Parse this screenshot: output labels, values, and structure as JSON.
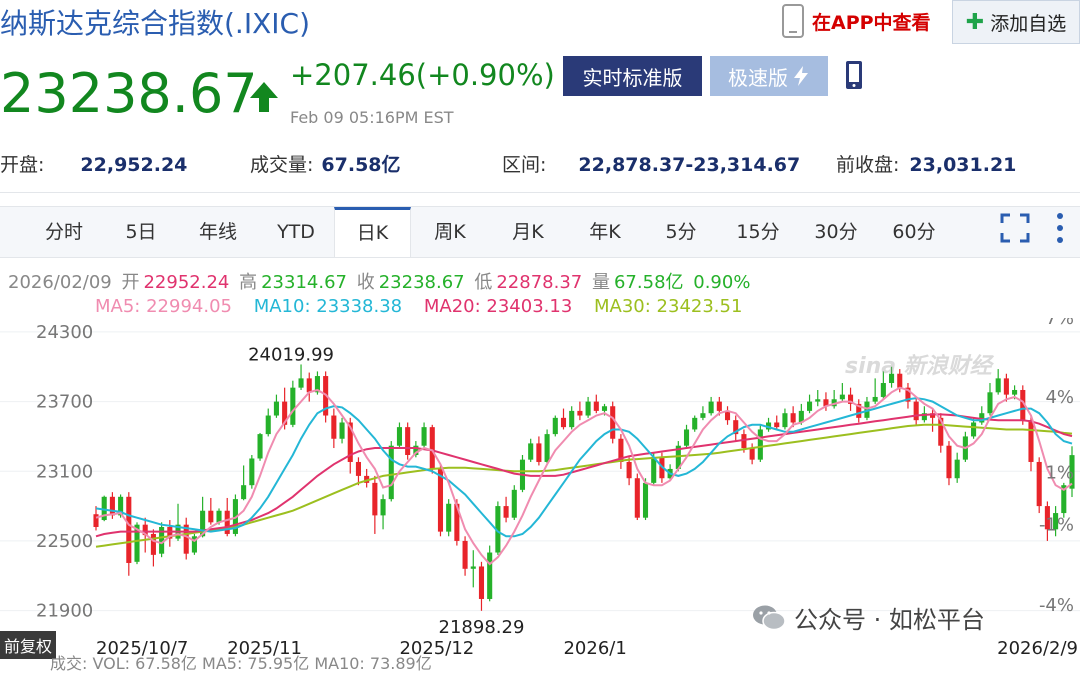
{
  "header": {
    "title": "纳斯达克综合指数(.IXIC)",
    "app_link": "在APP中查看",
    "add_watchlist": "添加自选",
    "price": "23238.67",
    "change": "+207.46(+0.90%)",
    "timestamp": "Feb 09 05:16PM EST",
    "realtime_label": "实时标准版",
    "fast_label": "极速版",
    "colors": {
      "up": "#12871f",
      "title": "#2a5db0",
      "app": "#d40000"
    }
  },
  "stats": [
    {
      "label": "开盘:",
      "value": "22,952.24"
    },
    {
      "label": "成交量:",
      "value": "67.58亿"
    },
    {
      "label": "区间:",
      "value": "22,878.37-23,314.67"
    },
    {
      "label": "前收盘:",
      "value": "23,031.21"
    }
  ],
  "tabs": [
    "分时",
    "5日",
    "年线",
    "YTD",
    "日K",
    "周K",
    "月K",
    "年K",
    "5分",
    "15分",
    "30分",
    "60分"
  ],
  "active_tab": "日K",
  "ohlc_line": {
    "date": "2026/02/09",
    "open_label": "开",
    "open": "22952.24",
    "high_label": "高",
    "high": "23314.67",
    "close_label": "收",
    "close": "23238.67",
    "low_label": "低",
    "low": "22878.37",
    "vol_label": "量",
    "vol": "67.58亿",
    "pct": "0.90%"
  },
  "ma_legend": [
    {
      "text": "MA5: 22994.05",
      "color": "#f08cb0"
    },
    {
      "text": "MA10: 23338.38",
      "color": "#24b7d6"
    },
    {
      "text": "MA20: 23403.13",
      "color": "#e0336e"
    },
    {
      "text": "MA30: 23423.51",
      "color": "#9cbf1f"
    }
  ],
  "chart_data": {
    "type": "candlestick",
    "y_ticks": [
      "24300",
      "23700",
      "23100",
      "22500",
      "21900"
    ],
    "y_tick_values": [
      24300,
      23700,
      23100,
      22500,
      21900
    ],
    "right_ticks": [
      "7%",
      "4%",
      "1%",
      "-1%",
      "-4%"
    ],
    "x_labels": [
      "2025/10/7",
      "2025/11",
      "2025/12",
      "2026/1",
      "2026/2/9"
    ],
    "x_label_index": [
      0,
      16,
      37,
      57,
      85
    ],
    "annotations": [
      {
        "text": "24019.99",
        "value": 24019.99
      },
      {
        "text": "21898.29",
        "value": 21898.29
      }
    ],
    "ylim": [
      21750,
      24420
    ],
    "up_color": "#25b12a",
    "down_color": "#e8242a",
    "candles": [
      [
        22730,
        22620,
        22800,
        22590
      ],
      [
        22680,
        22880,
        22890,
        22670
      ],
      [
        22880,
        22720,
        22920,
        22690
      ],
      [
        22720,
        22880,
        22900,
        22700
      ],
      [
        22880,
        22310,
        22920,
        22200
      ],
      [
        22320,
        22640,
        22660,
        22300
      ],
      [
        22640,
        22550,
        22700,
        22400
      ],
      [
        22560,
        22380,
        22600,
        22280
      ],
      [
        22390,
        22620,
        22660,
        22360
      ],
      [
        22620,
        22520,
        22680,
        22450
      ],
      [
        22520,
        22640,
        22820,
        22500
      ],
      [
        22640,
        22390,
        22700,
        22340
      ],
      [
        22400,
        22540,
        22560,
        22380
      ],
      [
        22540,
        22760,
        22880,
        22530
      ],
      [
        22760,
        22660,
        22870,
        22640
      ],
      [
        22660,
        22760,
        22780,
        22640
      ],
      [
        22760,
        22560,
        22870,
        22540
      ],
      [
        22560,
        22860,
        22900,
        22540
      ],
      [
        22860,
        22980,
        23150,
        22850
      ],
      [
        22980,
        23210,
        23240,
        22950
      ],
      [
        23210,
        23420,
        23430,
        23190
      ],
      [
        23420,
        23580,
        23640,
        23400
      ],
      [
        23580,
        23700,
        23760,
        23560
      ],
      [
        23700,
        23500,
        23820,
        23460
      ],
      [
        23500,
        23820,
        23880,
        23480
      ],
      [
        23820,
        23900,
        24020,
        23800
      ],
      [
        23900,
        23780,
        23950,
        23700
      ],
      [
        23780,
        23920,
        23960,
        23760
      ],
      [
        23920,
        23580,
        23960,
        23520
      ],
      [
        23580,
        23380,
        23640,
        23300
      ],
      [
        23380,
        23520,
        23560,
        23340
      ],
      [
        23520,
        23180,
        23560,
        23080
      ],
      [
        23180,
        23060,
        23220,
        22980
      ],
      [
        23060,
        23000,
        23120,
        22960
      ],
      [
        23000,
        22720,
        23060,
        22560
      ],
      [
        22720,
        22860,
        22900,
        22600
      ],
      [
        22860,
        23320,
        23360,
        22840
      ],
      [
        23320,
        23480,
        23520,
        23300
      ],
      [
        23480,
        23240,
        23520,
        23200
      ],
      [
        23240,
        23320,
        23360,
        23220
      ],
      [
        23320,
        23480,
        23520,
        23300
      ],
      [
        23480,
        23120,
        23500,
        23080
      ],
      [
        23120,
        22580,
        23160,
        22540
      ],
      [
        22580,
        22820,
        22860,
        22540
      ],
      [
        22820,
        22500,
        22860,
        22460
      ],
      [
        22500,
        22260,
        22540,
        22200
      ],
      [
        22260,
        22280,
        22420,
        22100
      ],
      [
        22280,
        22000,
        22320,
        21898
      ],
      [
        22000,
        22400,
        22460,
        21980
      ],
      [
        22400,
        22800,
        22840,
        22380
      ],
      [
        22800,
        22700,
        22880,
        22660
      ],
      [
        22700,
        22940,
        22980,
        22680
      ],
      [
        22940,
        23200,
        23240,
        22920
      ],
      [
        23200,
        23340,
        23380,
        23180
      ],
      [
        23340,
        23180,
        23400,
        23150
      ],
      [
        23180,
        23420,
        23460,
        23160
      ],
      [
        23420,
        23560,
        23580,
        23400
      ],
      [
        23560,
        23480,
        23640,
        23460
      ],
      [
        23480,
        23620,
        23660,
        23460
      ],
      [
        23620,
        23580,
        23700,
        23540
      ],
      [
        23580,
        23700,
        23740,
        23560
      ],
      [
        23700,
        23620,
        23760,
        23600
      ],
      [
        23620,
        23660,
        23680,
        23580
      ],
      [
        23660,
        23380,
        23700,
        23340
      ],
      [
        23380,
        23180,
        23420,
        23120
      ],
      [
        23180,
        23040,
        23220,
        22980
      ],
      [
        23040,
        22700,
        23080,
        22680
      ],
      [
        22700,
        23000,
        23040,
        22680
      ],
      [
        23000,
        23220,
        23260,
        22980
      ],
      [
        23220,
        23040,
        23260,
        23000
      ],
      [
        23040,
        23120,
        23160,
        23020
      ],
      [
        23120,
        23320,
        23360,
        23100
      ],
      [
        23320,
        23460,
        23500,
        23300
      ],
      [
        23460,
        23560,
        23580,
        23440
      ],
      [
        23560,
        23600,
        23660,
        23540
      ],
      [
        23600,
        23700,
        23740,
        23580
      ],
      [
        23700,
        23620,
        23740,
        23580
      ],
      [
        23620,
        23540,
        23660,
        23500
      ],
      [
        23540,
        23420,
        23580,
        23360
      ],
      [
        23420,
        23300,
        23460,
        23260
      ],
      [
        23300,
        23200,
        23340,
        23160
      ],
      [
        23200,
        23460,
        23500,
        23180
      ],
      [
        23460,
        23520,
        23560,
        23440
      ],
      [
        23520,
        23480,
        23580,
        23460
      ],
      [
        23480,
        23600,
        23640,
        23460
      ],
      [
        23600,
        23520,
        23660,
        23480
      ],
      [
        23520,
        23620,
        23680,
        23500
      ],
      [
        23620,
        23700,
        23760,
        23600
      ],
      [
        23700,
        23720,
        23800,
        23660
      ],
      [
        23720,
        23660,
        23780,
        23620
      ],
      [
        23660,
        23720,
        23800,
        23640
      ],
      [
        23720,
        23760,
        23860,
        23700
      ],
      [
        23760,
        23680,
        23820,
        23620
      ],
      [
        23680,
        23560,
        23720,
        23520
      ],
      [
        23560,
        23700,
        23740,
        23540
      ],
      [
        23700,
        23740,
        23900,
        23680
      ],
      [
        23740,
        23860,
        23960,
        23720
      ],
      [
        23860,
        23940,
        24000,
        23820
      ],
      [
        23940,
        23820,
        23980,
        23780
      ],
      [
        23820,
        23700,
        23860,
        23640
      ],
      [
        23700,
        23540,
        23740,
        23500
      ],
      [
        23540,
        23600,
        23660,
        23520
      ],
      [
        23600,
        23560,
        23640,
        23440
      ],
      [
        23560,
        23320,
        23600,
        23260
      ],
      [
        23320,
        23040,
        23360,
        22980
      ],
      [
        23040,
        23200,
        23260,
        23000
      ],
      [
        23200,
        23400,
        23440,
        23180
      ],
      [
        23400,
        23520,
        23560,
        23380
      ],
      [
        23520,
        23600,
        23660,
        23500
      ],
      [
        23600,
        23780,
        23860,
        23580
      ],
      [
        23780,
        23900,
        23980,
        23760
      ],
      [
        23900,
        23760,
        23940,
        23700
      ],
      [
        23760,
        23800,
        23840,
        23720
      ],
      [
        23800,
        23540,
        23840,
        23500
      ],
      [
        23540,
        23180,
        23580,
        23100
      ],
      [
        23180,
        22800,
        23220,
        22740
      ],
      [
        22800,
        22600,
        22840,
        22500
      ],
      [
        22600,
        22740,
        22800,
        22540
      ],
      [
        22740,
        22980,
        23000,
        22700
      ],
      [
        22950,
        23239,
        23315,
        22878
      ]
    ],
    "ma5": [
      22700,
      22720,
      22730,
      22740,
      22640,
      22600,
      22560,
      22500,
      22480,
      22540,
      22560,
      22540,
      22500,
      22560,
      22620,
      22660,
      22680,
      22700,
      22760,
      22880,
      23060,
      23260,
      23420,
      23520,
      23620,
      23700,
      23780,
      23800,
      23760,
      23680,
      23580,
      23480,
      23340,
      23220,
      23120,
      22960,
      22980,
      23100,
      23180,
      23260,
      23300,
      23280,
      23160,
      23000,
      22800,
      22600,
      22480,
      22380,
      22300,
      22360,
      22460,
      22580,
      22720,
      22880,
      23020,
      23160,
      23280,
      23360,
      23440,
      23500,
      23540,
      23580,
      23600,
      23560,
      23460,
      23320,
      23120,
      23000,
      22980,
      22980,
      23020,
      23120,
      23220,
      23340,
      23460,
      23540,
      23600,
      23620,
      23600,
      23520,
      23440,
      23380,
      23360,
      23360,
      23420,
      23500,
      23520,
      23560,
      23620,
      23660,
      23680,
      23700,
      23700,
      23660,
      23640,
      23660,
      23720,
      23780,
      23820,
      23800,
      23740,
      23680,
      23640,
      23540,
      23400,
      23320,
      23300,
      23340,
      23420,
      23560,
      23680,
      23720,
      23740,
      23700,
      23580,
      23360,
      23120,
      22980,
      22940,
      22994
    ],
    "ma10": [
      22780,
      22770,
      22760,
      22750,
      22720,
      22700,
      22680,
      22660,
      22640,
      22630,
      22620,
      22610,
      22600,
      22590,
      22580,
      22590,
      22600,
      22610,
      22640,
      22700,
      22780,
      22880,
      23000,
      23120,
      23240,
      23380,
      23500,
      23600,
      23640,
      23660,
      23650,
      23600,
      23540,
      23460,
      23380,
      23280,
      23200,
      23160,
      23140,
      23140,
      23120,
      23100,
      23060,
      23020,
      22960,
      22900,
      22820,
      22740,
      22660,
      22580,
      22540,
      22540,
      22560,
      22620,
      22700,
      22800,
      22900,
      23000,
      23100,
      23200,
      23280,
      23360,
      23420,
      23460,
      23460,
      23440,
      23380,
      23300,
      23220,
      23140,
      23080,
      23060,
      23080,
      23120,
      23180,
      23260,
      23340,
      23400,
      23440,
      23480,
      23500,
      23500,
      23480,
      23460,
      23440,
      23440,
      23460,
      23480,
      23500,
      23520,
      23540,
      23560,
      23580,
      23600,
      23620,
      23640,
      23660,
      23680,
      23700,
      23720,
      23730,
      23720,
      23700,
      23660,
      23620,
      23580,
      23560,
      23540,
      23540,
      23560,
      23580,
      23600,
      23620,
      23640,
      23640,
      23600,
      23520,
      23420,
      23360,
      23338
    ],
    "ma20": [
      22540,
      22560,
      22570,
      22580,
      22580,
      22580,
      22580,
      22580,
      22580,
      22580,
      22580,
      22580,
      22580,
      22590,
      22600,
      22610,
      22620,
      22640,
      22660,
      22680,
      22710,
      22740,
      22780,
      22830,
      22880,
      22940,
      23000,
      23060,
      23110,
      23160,
      23200,
      23240,
      23270,
      23290,
      23300,
      23300,
      23300,
      23300,
      23300,
      23300,
      23290,
      23280,
      23260,
      23240,
      23220,
      23200,
      23180,
      23160,
      23140,
      23120,
      23100,
      23080,
      23070,
      23060,
      23060,
      23060,
      23060,
      23070,
      23090,
      23110,
      23130,
      23150,
      23170,
      23190,
      23210,
      23230,
      23240,
      23250,
      23260,
      23270,
      23280,
      23290,
      23300,
      23310,
      23320,
      23330,
      23340,
      23350,
      23360,
      23370,
      23380,
      23390,
      23400,
      23410,
      23420,
      23430,
      23440,
      23450,
      23460,
      23470,
      23480,
      23490,
      23500,
      23510,
      23520,
      23530,
      23540,
      23550,
      23560,
      23570,
      23580,
      23585,
      23590,
      23590,
      23585,
      23580,
      23570,
      23560,
      23550,
      23545,
      23540,
      23540,
      23540,
      23540,
      23530,
      23510,
      23480,
      23450,
      23420,
      23403
    ],
    "ma30": [
      22450,
      22460,
      22470,
      22480,
      22490,
      22500,
      22510,
      22520,
      22530,
      22540,
      22550,
      22560,
      22570,
      22580,
      22590,
      22600,
      22610,
      22620,
      22640,
      22660,
      22680,
      22700,
      22720,
      22740,
      22760,
      22790,
      22820,
      22850,
      22880,
      22910,
      22940,
      22970,
      23000,
      23020,
      23040,
      23060,
      23070,
      23080,
      23090,
      23100,
      23110,
      23120,
      23125,
      23130,
      23130,
      23130,
      23125,
      23120,
      23115,
      23110,
      23105,
      23100,
      23100,
      23100,
      23100,
      23105,
      23110,
      23120,
      23130,
      23140,
      23150,
      23160,
      23170,
      23180,
      23190,
      23200,
      23205,
      23210,
      23215,
      23220,
      23225,
      23230,
      23235,
      23240,
      23245,
      23250,
      23260,
      23270,
      23280,
      23290,
      23300,
      23310,
      23320,
      23330,
      23340,
      23350,
      23360,
      23370,
      23380,
      23390,
      23400,
      23410,
      23420,
      23430,
      23440,
      23450,
      23460,
      23470,
      23480,
      23490,
      23495,
      23500,
      23500,
      23500,
      23495,
      23490,
      23485,
      23480,
      23475,
      23470,
      23465,
      23460,
      23460,
      23460,
      23455,
      23450,
      23445,
      23440,
      23430,
      23424
    ]
  },
  "watermarks": {
    "sina": "sina 新浪财经",
    "wechat": "公众号 · 如松平台"
  },
  "fq_badge": "前复权",
  "vol_strip": "成交: VOL: 67.58亿  MA5: 75.95亿  MA10: 73.89亿"
}
